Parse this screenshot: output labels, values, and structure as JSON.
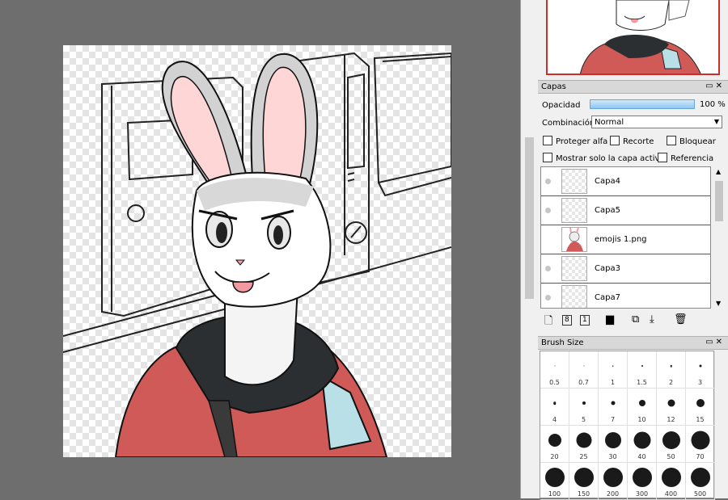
{
  "layers_panel": {
    "title": "Capas",
    "opacity_label": "Opacidad",
    "opacity_value": "100 %",
    "blend_label": "Combinación",
    "blend_value": "Normal",
    "checkboxes": {
      "protect_alpha": "Proteger alfa",
      "clipping": "Recorte",
      "lock": "Bloquear",
      "show_active_only": "Mostrar solo la capa activa",
      "reference": "Referencia"
    },
    "layers": [
      {
        "name": "Capa4"
      },
      {
        "name": "Capa5"
      },
      {
        "name": "emojis 1.png"
      },
      {
        "name": "Capa3"
      },
      {
        "name": "Capa7"
      }
    ],
    "toolbar_icons": [
      "new-layer-icon",
      "new-8bit-layer-icon",
      "new-1bit-layer-icon",
      "new-folder-icon",
      "copy-layer-icon",
      "merge-down-icon",
      "delete-layer-icon"
    ]
  },
  "brush_panel": {
    "title": "Brush Size",
    "sizes": [
      "0.5",
      "0.7",
      "1",
      "1.5",
      "2",
      "3",
      "4",
      "5",
      "7",
      "10",
      "12",
      "15",
      "20",
      "25",
      "30",
      "40",
      "50",
      "70",
      "100",
      "150",
      "200",
      "300",
      "400",
      "500"
    ]
  },
  "colors": {
    "jacket": "#d05a57",
    "patch": "#b8e0e6",
    "ear_inner": "#ffd6d6",
    "collar": "#2b2f31",
    "accent_border": "#cc2d2d"
  }
}
